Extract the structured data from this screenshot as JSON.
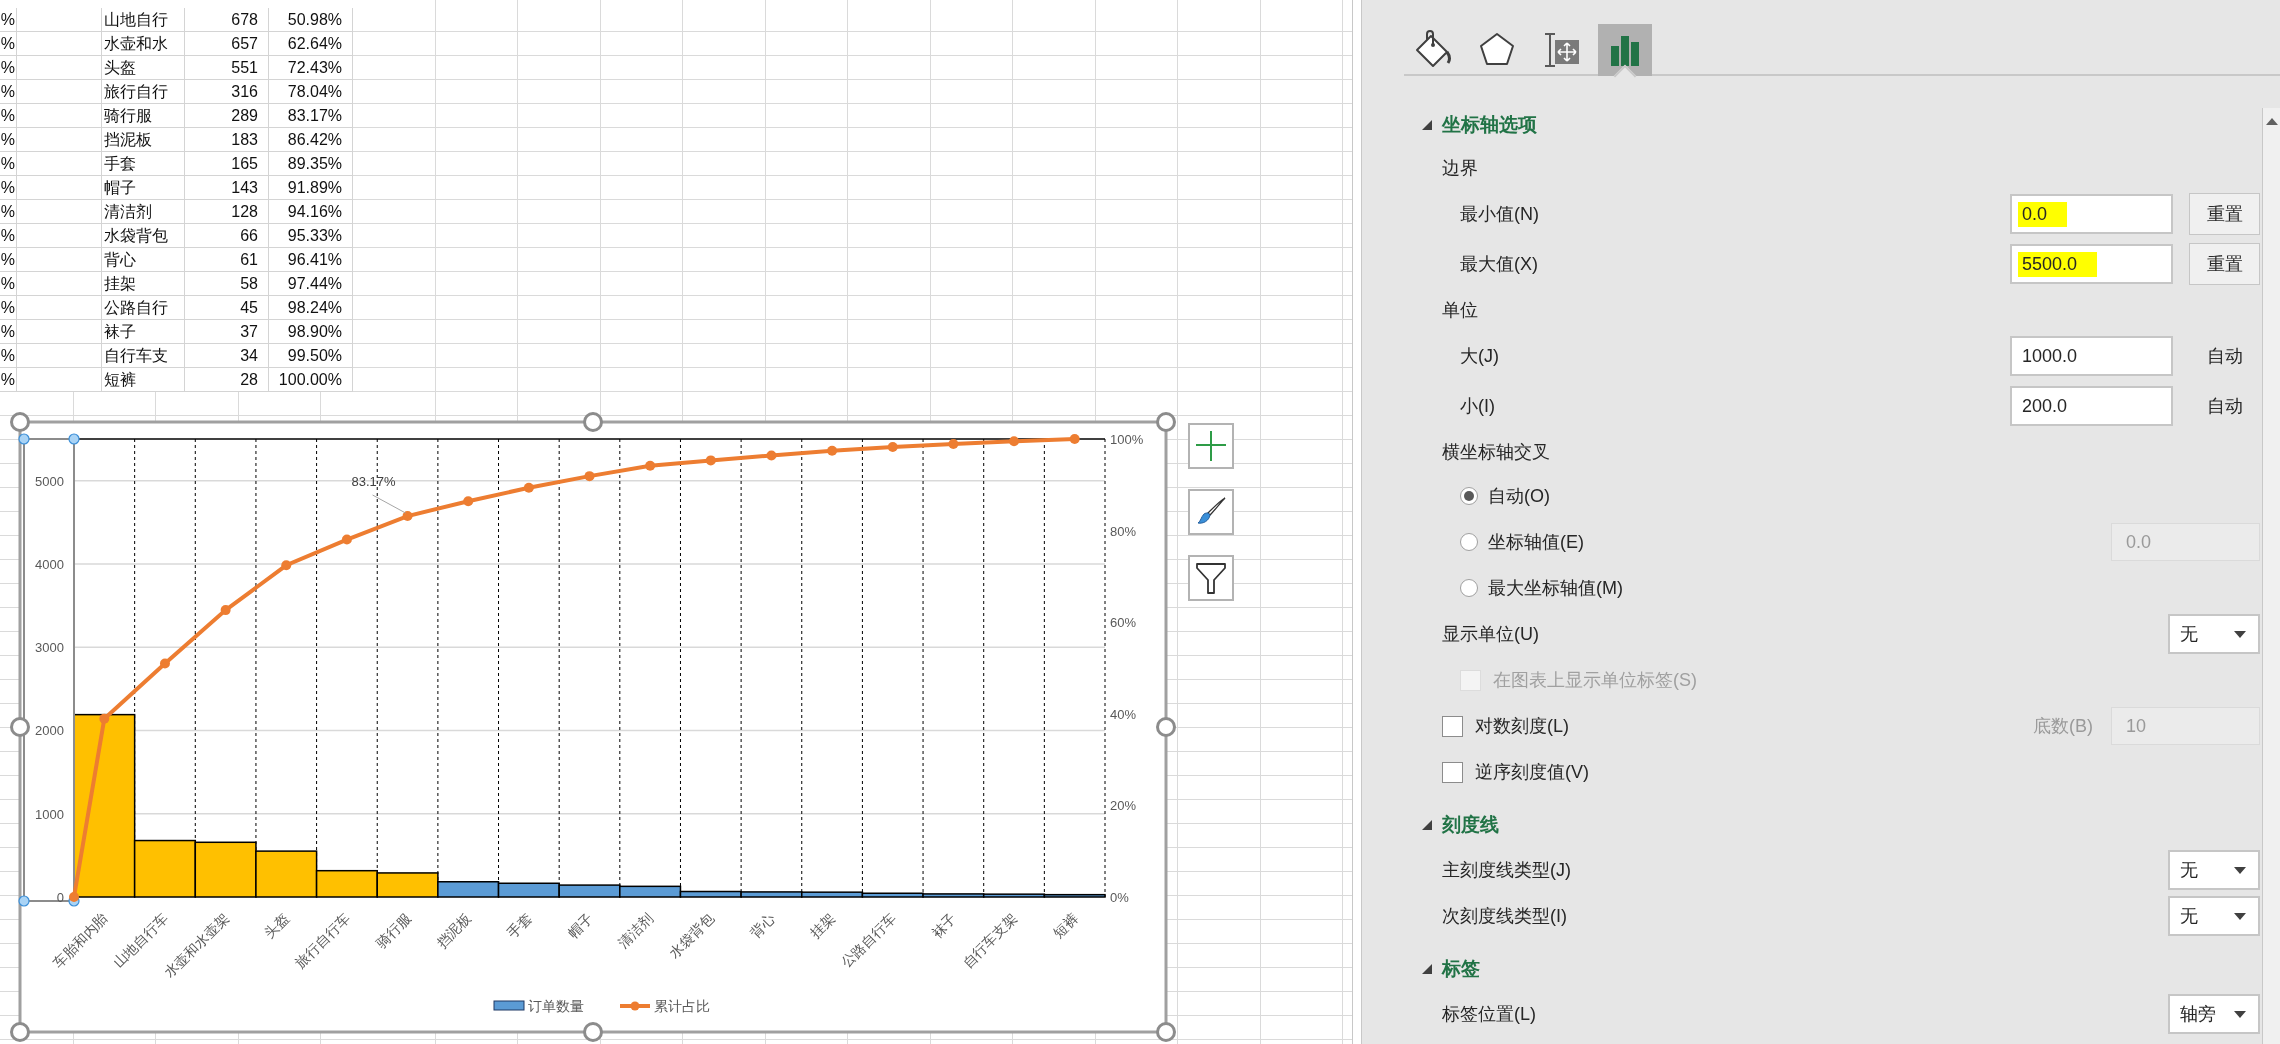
{
  "sheet": {
    "rows": [
      {
        "col_a": "%",
        "name": "山地自行",
        "count": "678",
        "share": "50.98%"
      },
      {
        "col_a": "%",
        "name": "水壶和水",
        "count": "657",
        "share": "62.64%"
      },
      {
        "col_a": "%",
        "name": "头盔",
        "count": "551",
        "share": "72.43%"
      },
      {
        "col_a": "%",
        "name": "旅行自行",
        "count": "316",
        "share": "78.04%"
      },
      {
        "col_a": "%",
        "name": "骑行服",
        "count": "289",
        "share": "83.17%"
      },
      {
        "col_a": "%",
        "name": "挡泥板",
        "count": "183",
        "share": "86.42%"
      },
      {
        "col_a": "%",
        "name": "手套",
        "count": "165",
        "share": "89.35%"
      },
      {
        "col_a": "%",
        "name": "帽子",
        "count": "143",
        "share": "91.89%"
      },
      {
        "col_a": "%",
        "name": "清洁剂",
        "count": "128",
        "share": "94.16%"
      },
      {
        "col_a": "%",
        "name": "水袋背包",
        "count": "66",
        "share": "95.33%"
      },
      {
        "col_a": "%",
        "name": "背心",
        "count": "61",
        "share": "96.41%"
      },
      {
        "col_a": "%",
        "name": "挂架",
        "count": "58",
        "share": "97.44%"
      },
      {
        "col_a": "%",
        "name": "公路自行",
        "count": "45",
        "share": "98.24%"
      },
      {
        "col_a": "%",
        "name": "袜子",
        "count": "37",
        "share": "98.90%"
      },
      {
        "col_a": "%",
        "name": "自行车支",
        "count": "34",
        "share": "99.50%"
      },
      {
        "col_a": "%",
        "name": "短裤",
        "count": "28",
        "share": "100.00%"
      }
    ]
  },
  "chart": {
    "chart_data": {
      "type": "bar",
      "categories": [
        "车胎和内胎",
        "山地自行车",
        "水壶和水壶架",
        "头盔",
        "旅行自行车",
        "骑行服",
        "挡泥板",
        "手套",
        "帽子",
        "清洁剂",
        "水袋背包",
        "背心",
        "挂架",
        "公路自行车",
        "袜子",
        "自行车支架",
        "短裤"
      ],
      "series": [
        {
          "name": "订单数量",
          "color": "#5b9bd5",
          "colors": [
            "#ffc000",
            "#ffc000",
            "#ffc000",
            "#ffc000",
            "#ffc000",
            "#ffc000",
            "#5b9bd5",
            "#5b9bd5",
            "#5b9bd5",
            "#5b9bd5",
            "#5b9bd5",
            "#5b9bd5",
            "#5b9bd5",
            "#5b9bd5",
            "#5b9bd5",
            "#5b9bd5",
            "#5b9bd5"
          ],
          "values": [
            2190,
            678,
            657,
            551,
            316,
            289,
            183,
            165,
            143,
            128,
            66,
            61,
            58,
            45,
            37,
            34,
            28
          ]
        },
        {
          "name": "累计占比",
          "color": "#ed7d31",
          "type": "line",
          "axis": "y2",
          "marker": "circle",
          "values": [
            38.94,
            50.98,
            62.64,
            72.43,
            78.04,
            83.17,
            86.42,
            89.35,
            91.89,
            94.16,
            95.33,
            96.41,
            97.44,
            98.24,
            98.9,
            99.5,
            100.0
          ]
        }
      ],
      "ylim": [
        0,
        5500
      ],
      "yticks": [
        0,
        1000,
        2000,
        3000,
        4000,
        5000
      ],
      "y2lim": [
        0,
        100
      ],
      "y2ticks": [
        {
          "value": 0,
          "label": "0%"
        },
        {
          "value": 20,
          "label": "20%"
        },
        {
          "value": 40,
          "label": "40%"
        },
        {
          "value": 60,
          "label": "60%"
        },
        {
          "value": 80,
          "label": "80%"
        },
        {
          "value": 100,
          "label": "100%"
        }
      ],
      "grid": true,
      "legend": true,
      "annotations": [
        {
          "text": "83.17%"
        }
      ]
    }
  },
  "format_pane": {
    "tabs": [
      {
        "kind": "fill",
        "selected": false
      },
      {
        "kind": "effects",
        "selected": false
      },
      {
        "kind": "size",
        "selected": false
      },
      {
        "kind": "axis",
        "selected": true
      }
    ],
    "sections": [
      {
        "title": "坐标轴选项",
        "expanded": true,
        "items": [
          {
            "kind": "group",
            "label": "边界",
            "children": [
              {
                "kind": "field",
                "label": "最小值(N)",
                "value": "0.0",
                "highlighted": true,
                "button": "重置"
              },
              {
                "kind": "field",
                "label": "最大值(X)",
                "value": "5500.0",
                "highlighted": true,
                "button": "重置"
              }
            ]
          },
          {
            "kind": "group",
            "label": "单位",
            "children": [
              {
                "kind": "field",
                "label": "大(J)",
                "value": "1000.0",
                "note": "自动"
              },
              {
                "kind": "field",
                "label": "小(I)",
                "value": "200.0",
                "note": "自动"
              }
            ]
          },
          {
            "kind": "group",
            "label": "横坐标轴交叉",
            "children": [
              {
                "kind": "radio",
                "label": "自动(O)",
                "selected": true
              },
              {
                "kind": "radio",
                "label": "坐标轴值(E)",
                "selected": false,
                "value": "0.0",
                "value_disabled": true
              },
              {
                "kind": "radio",
                "label": "最大坐标轴值(M)",
                "selected": false
              }
            ]
          },
          {
            "kind": "dropdown",
            "label": "显示单位(U)",
            "value": "无",
            "children": [
              {
                "kind": "checkbox",
                "label": "在图表上显示单位标签(S)",
                "checked": false,
                "disabled": true
              }
            ]
          },
          {
            "kind": "checkbox",
            "label": "对数刻度(L)",
            "checked": false,
            "disabled": false,
            "aux_label": "底数(B)",
            "value": "10",
            "value_disabled": true
          },
          {
            "kind": "checkbox",
            "label": "逆序刻度值(V)",
            "checked": false,
            "disabled": false
          }
        ]
      },
      {
        "title": "刻度线",
        "expanded": true,
        "items": [
          {
            "kind": "dropdown",
            "label": "主刻度线类型(J)",
            "value": "无"
          },
          {
            "kind": "dropdown",
            "label": "次刻度线类型(I)",
            "value": "无"
          }
        ]
      },
      {
        "title": "标签",
        "expanded": true,
        "items": [
          {
            "kind": "dropdown",
            "label": "标签位置(L)",
            "value": "轴旁"
          }
        ]
      }
    ]
  }
}
